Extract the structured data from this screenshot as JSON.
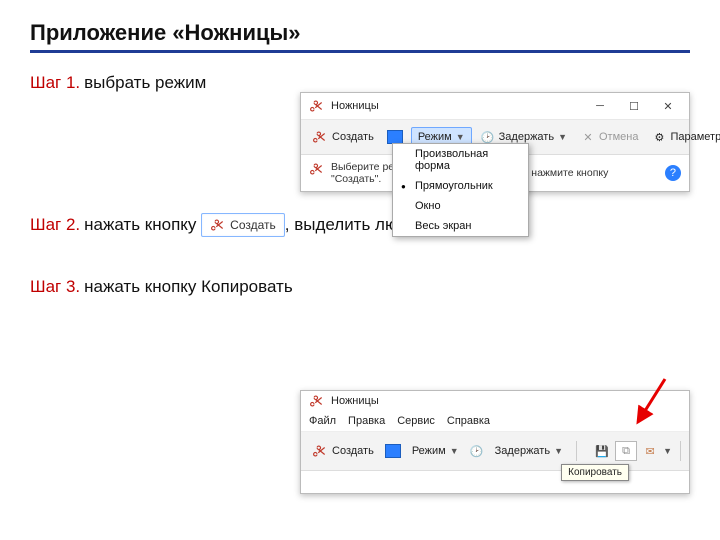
{
  "title": "Приложение «Ножницы»",
  "steps": {
    "s1": {
      "num": "Шаг 1.",
      "text": "выбрать режим"
    },
    "s2": {
      "num": "Шаг 2.",
      "text_before": "нажать кнопку",
      "btn": "Создать",
      "text_after": ", выделить любой фрагмент"
    },
    "s3": {
      "num": "Шаг 3.",
      "text": "нажать кнопку Копировать"
    }
  },
  "win1": {
    "title": "Ножницы",
    "toolbar": {
      "create": "Создать",
      "mode": "Режим",
      "delay": "Задержать",
      "cancel": "Отмена",
      "options": "Параметры"
    },
    "hint_a": "Выберите ре",
    "hint_b": "\"Создать\".",
    "hint_tail": "им\" или нажмите кнопку",
    "dropdown": {
      "i0": "Произвольная форма",
      "i1": "Прямоугольник",
      "i2": "Окно",
      "i3": "Весь экран"
    }
  },
  "win2": {
    "title": "Ножницы",
    "menu": {
      "file": "Файл",
      "edit": "Правка",
      "tools": "Сервис",
      "help": "Справка"
    },
    "toolbar": {
      "create": "Создать",
      "mode": "Режим",
      "delay": "Задержать"
    },
    "tooltip": "Копировать"
  }
}
